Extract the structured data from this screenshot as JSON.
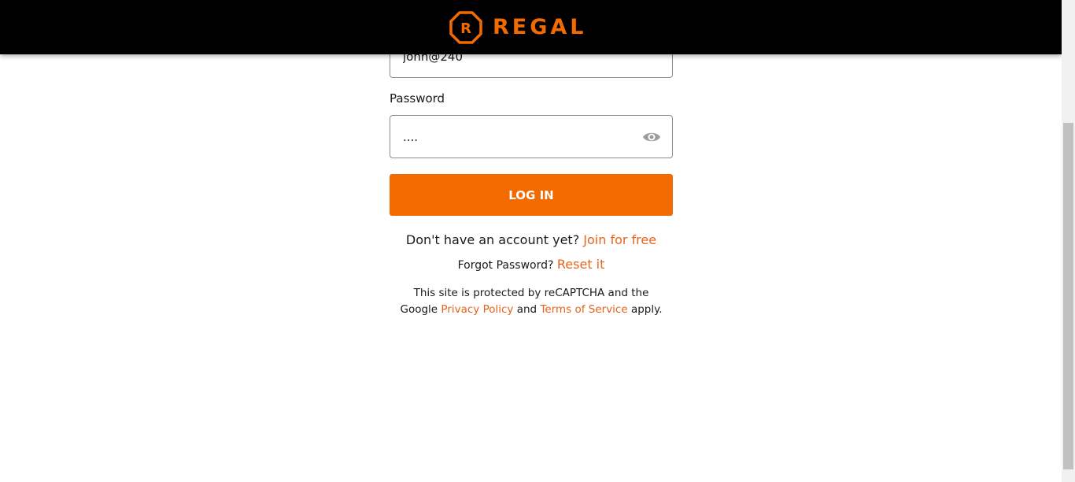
{
  "colors": {
    "brand_orange": "#f26b00",
    "header_bg": "#000000",
    "link_orange": "#e8631a"
  },
  "header": {
    "logo_text": "REGAL",
    "logo_icon": "regal-r-octagon-icon"
  },
  "form": {
    "email_value": "john@240",
    "password_label": "Password",
    "password_value": "....",
    "password_icon": "eye-icon",
    "login_label": "LOG IN"
  },
  "links": {
    "join_prompt": "Don't have an account yet?",
    "join_link": "Join for free",
    "forgot_prompt": "Forgot Password?",
    "reset_link": "Reset it"
  },
  "captcha": {
    "line1": "This site is protected by reCAPTCHA and the",
    "prefix": "Google",
    "privacy_link": "Privacy Policy",
    "and": "and",
    "terms_link": "Terms of Service",
    "suffix": "apply."
  }
}
